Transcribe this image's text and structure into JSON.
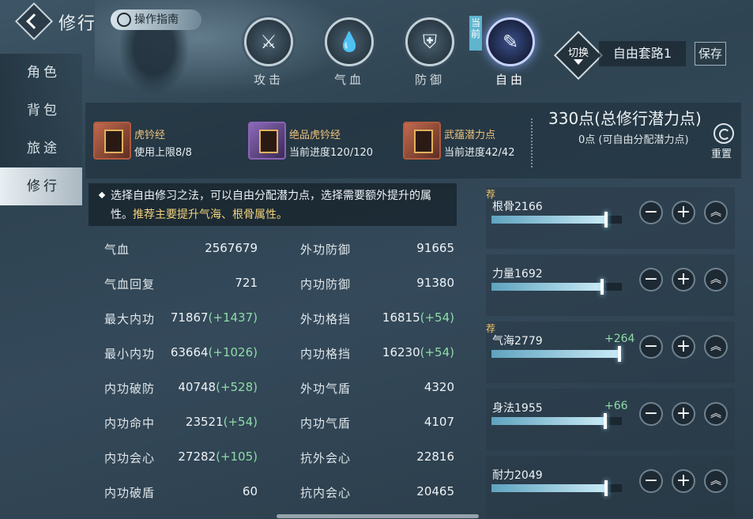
{
  "title": "修行",
  "guide": "操作指南",
  "tabs": [
    {
      "label": "攻击"
    },
    {
      "label": "气血"
    },
    {
      "label": "防御"
    },
    {
      "label": "自由"
    }
  ],
  "current_tag": "当前",
  "switch_label": "切换",
  "plan_name": "自由套路1",
  "save_label": "保存",
  "sidebar": [
    "角色",
    "背包",
    "旅途",
    "修行"
  ],
  "items": [
    {
      "name": "虎钤经",
      "sub": "使用上限8/8"
    },
    {
      "name": "绝品虎钤经",
      "sub": "当前进度120/120"
    },
    {
      "name": "武蕴潜力点",
      "sub": "当前进度42/42"
    }
  ],
  "points_total": "330点(总修行潜力点)",
  "points_free": "0点 (可自由分配潜力点)",
  "reset_label": "重置",
  "tip": {
    "text": "选择自由修习之法，可以自由分配潜力点，选择需要额外提升的属性。",
    "recommend": "推荐主要提升气海、根骨属性。"
  },
  "stats_left": [
    {
      "label": "气血",
      "value": "2567679",
      "bonus": ""
    },
    {
      "label": "气血回复",
      "value": "721",
      "bonus": ""
    },
    {
      "label": "最大内功",
      "value": "71867",
      "bonus": "(+1437)"
    },
    {
      "label": "最小内功",
      "value": "63664",
      "bonus": "(+1026)"
    },
    {
      "label": "内功破防",
      "value": "40748",
      "bonus": "(+528)"
    },
    {
      "label": "内功命中",
      "value": "23521",
      "bonus": "(+54)"
    },
    {
      "label": "内功会心",
      "value": "27282",
      "bonus": "(+105)"
    },
    {
      "label": "内功破盾",
      "value": "60",
      "bonus": ""
    }
  ],
  "stats_right": [
    {
      "label": "外功防御",
      "value": "91665",
      "bonus": ""
    },
    {
      "label": "内功防御",
      "value": "91380",
      "bonus": ""
    },
    {
      "label": "外功格挡",
      "value": "16815",
      "bonus": "(+54)"
    },
    {
      "label": "内功格挡",
      "value": "16230",
      "bonus": "(+54)"
    },
    {
      "label": "外功气盾",
      "value": "4320",
      "bonus": ""
    },
    {
      "label": "内功气盾",
      "value": "4107",
      "bonus": ""
    },
    {
      "label": "抗外会心",
      "value": "22816",
      "bonus": ""
    },
    {
      "label": "抗内会心",
      "value": "20465",
      "bonus": ""
    }
  ],
  "attributes": [
    {
      "label": "根骨2166",
      "add": "",
      "rec": "荐",
      "fill": 0.88
    },
    {
      "label": "力量1692",
      "add": "",
      "rec": "",
      "fill": 0.85
    },
    {
      "label": "气海2779",
      "add": "+264",
      "rec": "荐",
      "fill": 0.98
    },
    {
      "label": "身法1955",
      "add": "+66",
      "rec": "",
      "fill": 0.87
    },
    {
      "label": "耐力2049",
      "add": "",
      "rec": "",
      "fill": 0.88
    }
  ],
  "buttons": {
    "minus": "−",
    "plus": "+",
    "up": "︽"
  },
  "colors": {
    "accent": "#f2d27a",
    "bonus": "#8fdca7",
    "active_tab": "#3a4f8a"
  }
}
